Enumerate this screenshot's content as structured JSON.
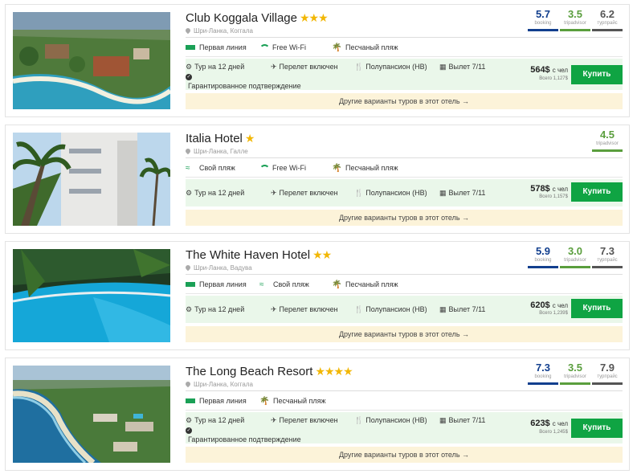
{
  "hotels": [
    {
      "name": "Club Koggala Village",
      "stars": "★★★",
      "location": "Шри-Ланка, Коггала",
      "features": [
        {
          "icon": "stripes-icon",
          "label": "Первая линия"
        },
        {
          "icon": "wifi-icon",
          "label": "Free Wi-Fi"
        },
        {
          "icon": "palm-icon",
          "label": "Песчаный пляж"
        }
      ],
      "ratings": [
        {
          "value": "5.7",
          "label": "booking",
          "color": "#123f8e"
        },
        {
          "value": "3.5",
          "label": "tripadvisor",
          "color": "#5a9e3d"
        },
        {
          "value": "6.2",
          "label": "турпрайс",
          "color": "#555555"
        }
      ],
      "tour": "Тур на 12 дней",
      "flight": "Перелет включен",
      "meal": "Полупансион (HB)",
      "departure": "Вылет 7/11",
      "guarantee": "Гарантированное подтверждение",
      "price": "564$",
      "per": "с чел",
      "total": "Всего 1,127$",
      "buy": "Купить",
      "other": "Другие варианты туров в этот отель →"
    },
    {
      "name": "Italia Hotel",
      "stars": "★",
      "location": "Шри-Ланка, Галле",
      "features": [
        {
          "icon": "wave-icon",
          "label": "Свой пляж"
        },
        {
          "icon": "wifi-icon",
          "label": "Free Wi-Fi"
        },
        {
          "icon": "palm-icon",
          "label": "Песчаный пляж"
        }
      ],
      "ratings": [
        {
          "value": "4.5",
          "label": "tripadvisor",
          "color": "#5a9e3d"
        }
      ],
      "tour": "Тур на 12 дней",
      "flight": "Перелет включен",
      "meal": "Полупансион (HB)",
      "departure": "Вылет 7/11",
      "guarantee": "",
      "price": "578$",
      "per": "с чел",
      "total": "Всего 1,157$",
      "buy": "Купить",
      "other": "Другие варианты туров в этот отель →"
    },
    {
      "name": "The White Haven Hotel",
      "stars": "★★",
      "location": "Шри-Ланка, Вадува",
      "features": [
        {
          "icon": "stripes-icon",
          "label": "Первая линия"
        },
        {
          "icon": "wave-icon",
          "label": "Свой пляж"
        },
        {
          "icon": "palm-icon",
          "label": "Песчаный пляж"
        }
      ],
      "ratings": [
        {
          "value": "5.9",
          "label": "booking",
          "color": "#123f8e"
        },
        {
          "value": "3.0",
          "label": "tripadvisor",
          "color": "#5a9e3d"
        },
        {
          "value": "7.3",
          "label": "турпрайс",
          "color": "#555555"
        }
      ],
      "tour": "Тур на 12 дней",
      "flight": "Перелет включен",
      "meal": "Полупансион (HB)",
      "departure": "Вылет 7/11",
      "guarantee": "",
      "price": "620$",
      "per": "с чел",
      "total": "Всего 1,239$",
      "buy": "Купить",
      "other": "Другие варианты туров в этот отель →"
    },
    {
      "name": "The Long Beach Resort",
      "stars": "★★★★",
      "location": "Шри-Ланка, Коггала",
      "features": [
        {
          "icon": "stripes-icon",
          "label": "Первая линия"
        },
        {
          "icon": "palm-icon",
          "label": "Песчаный пляж"
        }
      ],
      "ratings": [
        {
          "value": "7.3",
          "label": "booking",
          "color": "#123f8e"
        },
        {
          "value": "3.5",
          "label": "tripadvisor",
          "color": "#5a9e3d"
        },
        {
          "value": "7.9",
          "label": "турпрайс",
          "color": "#555555"
        }
      ],
      "tour": "Тур на 12 дней",
      "flight": "Перелет включен",
      "meal": "Полупансион (HB)",
      "departure": "Вылет 7/11",
      "guarantee": "Гарантированное подтверждение",
      "price": "623$",
      "per": "с чел",
      "total": "Всего 1,245$",
      "buy": "Купить",
      "other": "Другие варианты туров в этот отель →"
    }
  ],
  "colors": {
    "buy_button": "#0fa443",
    "stars": "#f2b705",
    "feature_icon": "#1aa056",
    "info_background": "#eaf7ea",
    "other_background": "#fcf3d9"
  }
}
